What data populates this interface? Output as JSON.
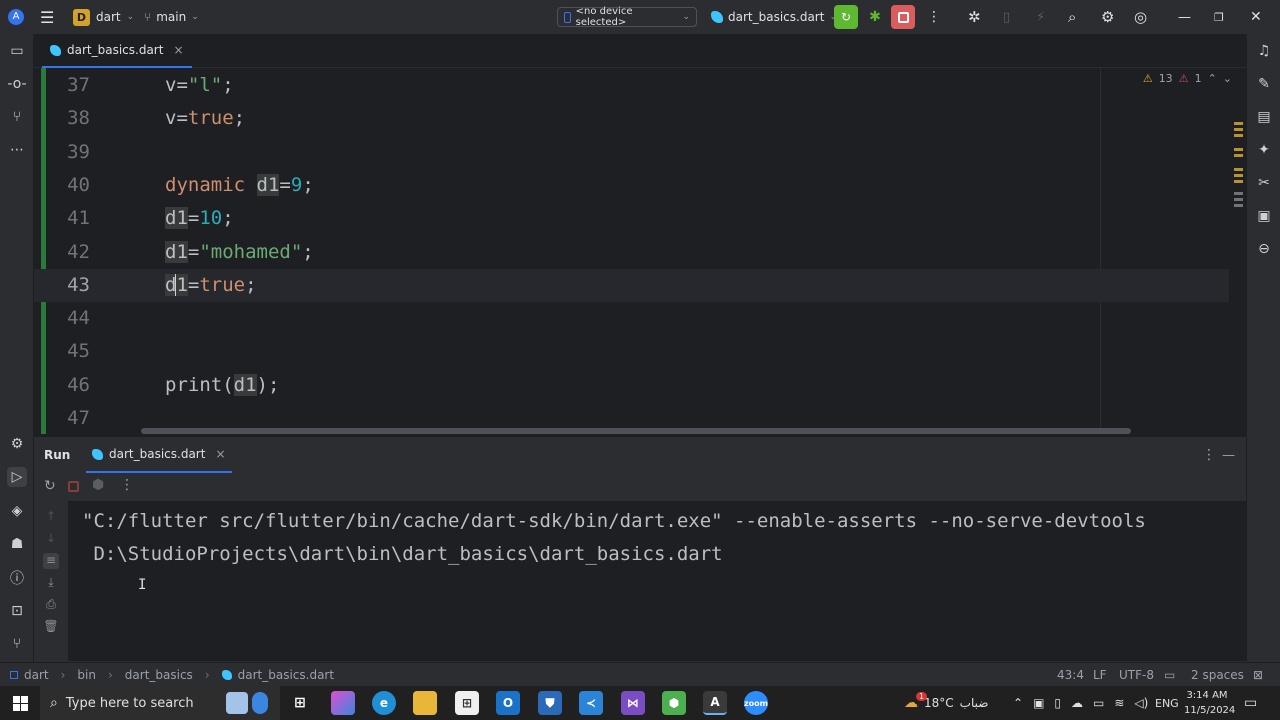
{
  "titlebar": {
    "project_badge": "D",
    "project_name": "dart",
    "branch": "main",
    "device": "<no device selected>",
    "run_config": "dart_basics.dart",
    "colors": {
      "badge": "#d3a22d",
      "run_btn": "#5fb832",
      "stop_btn": "#db5c5c"
    }
  },
  "editor_tab": {
    "label": "dart_basics.dart",
    "close": "×"
  },
  "inspections": {
    "warnings": "13",
    "errors": "1"
  },
  "editor_lines": [
    {
      "num": "37",
      "parts": [
        [
          "plain",
          "v="
        ],
        [
          "str",
          "\"l\""
        ],
        [
          "plain",
          ";"
        ]
      ]
    },
    {
      "num": "38",
      "parts": [
        [
          "plain",
          "v="
        ],
        [
          "kw",
          "true"
        ],
        [
          "plain",
          ";"
        ]
      ]
    },
    {
      "num": "39",
      "parts": []
    },
    {
      "num": "40",
      "parts": [
        [
          "kw",
          "dynamic "
        ],
        [
          "var",
          "d1"
        ],
        [
          "plain",
          "="
        ],
        [
          "num",
          "9"
        ],
        [
          "plain",
          ";"
        ]
      ]
    },
    {
      "num": "41",
      "parts": [
        [
          "var",
          "d1"
        ],
        [
          "plain",
          "="
        ],
        [
          "num",
          "10"
        ],
        [
          "plain",
          ";"
        ]
      ]
    },
    {
      "num": "42",
      "parts": [
        [
          "var",
          "d1"
        ],
        [
          "plain",
          "="
        ],
        [
          "str",
          "\"mohamed\""
        ],
        [
          "plain",
          ";"
        ]
      ]
    },
    {
      "num": "43",
      "current": true,
      "parts": [
        [
          "var",
          "d"
        ],
        [
          "caret",
          ""
        ],
        [
          "var",
          "1"
        ],
        [
          "plain",
          "="
        ],
        [
          "kw",
          "true"
        ],
        [
          "plain",
          ";"
        ]
      ]
    },
    {
      "num": "44",
      "parts": []
    },
    {
      "num": "45",
      "parts": []
    },
    {
      "num": "46",
      "parts": [
        [
          "plain",
          "print("
        ],
        [
          "var",
          "d1"
        ],
        [
          "plain",
          ");"
        ]
      ]
    },
    {
      "num": "47",
      "parts": []
    }
  ],
  "run_panel": {
    "title": "Run",
    "tab_label": "dart_basics.dart",
    "tab_close": "×",
    "console_lines": [
      "\"C:/flutter src/flutter/bin/cache/dart-sdk/bin/dart.exe\" --enable-asserts --no-serve-devtools",
      " D:\\StudioProjects\\dart\\bin\\dart_basics\\dart_basics.dart"
    ]
  },
  "statusbar": {
    "breadcrumb": [
      "dart",
      "bin",
      "dart_basics",
      "dart_basics.dart"
    ],
    "position": "43:4",
    "line_sep": "LF",
    "encoding": "UTF-8",
    "indent": "2 spaces"
  },
  "taskbar": {
    "search_placeholder": "Type here to search",
    "weather_temp": "18°C",
    "weather_text": "ضباب",
    "weather_badge": "1",
    "language": "ENG",
    "time": "3:14 AM",
    "date": "11/5/2024"
  }
}
